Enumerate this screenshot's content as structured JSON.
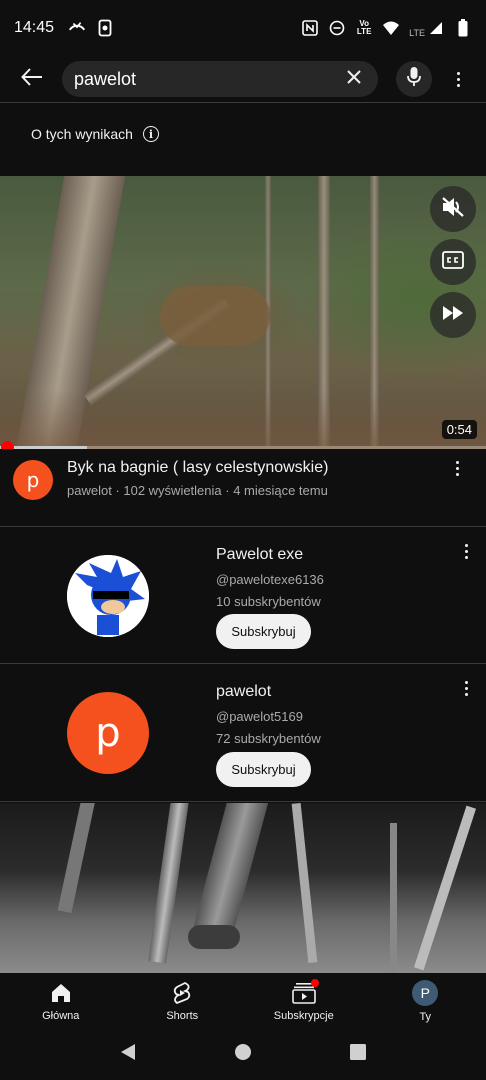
{
  "status_bar": {
    "time": "14:45",
    "network_label": "Vo LTE",
    "lte_label": "LTE",
    "icons": [
      "missed-call-icon",
      "screen-record-icon",
      "nfc-icon",
      "dnd-icon",
      "volte-icon",
      "wifi-icon",
      "signal-icon",
      "battery-icon"
    ]
  },
  "search": {
    "query": "pawelot",
    "icons": [
      "back-arrow-icon",
      "clear-icon",
      "mic-icon",
      "more-vert-icon"
    ]
  },
  "about": {
    "label": "O tych wynikach"
  },
  "video1": {
    "duration": "0:54",
    "title": "Byk na bagnie ( lasy celestynowskie)",
    "meta": "pawelot · 102 wyświetlenia · 4 miesiące temu",
    "avatar_letter": "p",
    "progress": 0.18
  },
  "channels": [
    {
      "name": "Pawelot exe",
      "handle": "@pawelotexe6136",
      "subs": "10 subskrybentów",
      "button": "Subskrybuj"
    },
    {
      "name": "pawelot",
      "handle": "@pawelot5169",
      "subs": "72 subskrybentów",
      "button": "Subskrybuj",
      "avatar_letter": "p"
    }
  ],
  "bottom_nav": {
    "home": "Główna",
    "shorts": "Shorts",
    "subscriptions": "Subskrypcje",
    "you": "Ty",
    "you_avatar_letter": "P"
  },
  "colors": {
    "background": "#0f0f0f",
    "accent_red": "#ff0000",
    "avatar_orange": "#f4511e",
    "chip": "#272727"
  }
}
